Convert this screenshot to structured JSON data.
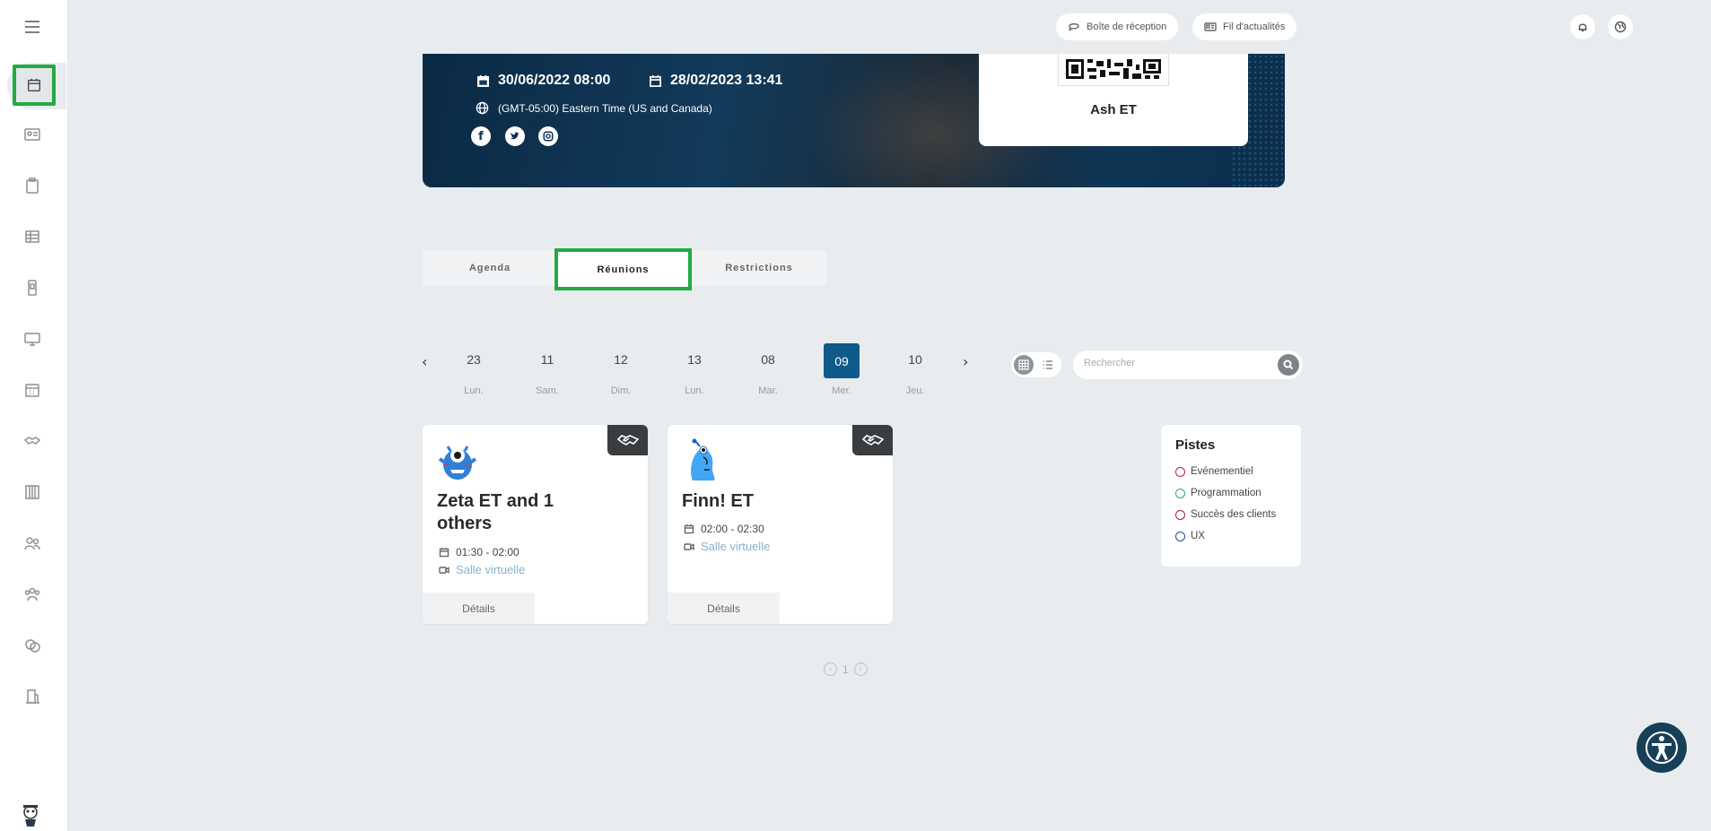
{
  "header": {
    "inbox_label": "Boîte de réception",
    "news_label": "Fil d'actualités"
  },
  "banner": {
    "start_date": "30/06/2022 08:00",
    "end_date": "28/02/2023 13:41",
    "timezone": "(GMT-05:00) Eastern Time (US and Canada)",
    "owner_name": "Ash ET",
    "social": [
      "facebook-icon",
      "twitter-icon",
      "instagram-icon"
    ]
  },
  "tabs": {
    "items": [
      "Agenda",
      "Réunions",
      "Restrictions"
    ],
    "active": "Réunions"
  },
  "dates": {
    "items": [
      {
        "num": "23",
        "day": "Lun."
      },
      {
        "num": "11",
        "day": "Sam."
      },
      {
        "num": "12",
        "day": "Dim."
      },
      {
        "num": "13",
        "day": "Lun."
      },
      {
        "num": "08",
        "day": "Mar."
      },
      {
        "num": "09",
        "day": "Mer."
      },
      {
        "num": "10",
        "day": "Jeu."
      }
    ],
    "selected": "09"
  },
  "search": {
    "placeholder": "Rechercher"
  },
  "meetings": [
    {
      "title": "Zeta ET and 1 others",
      "time": "01:30 - 02:00",
      "room": "Salle virtuelle",
      "details": "Détails"
    },
    {
      "title": "Finn! ET",
      "time": "02:00 - 02:30",
      "room": "Salle virtuelle",
      "details": "Détails"
    }
  ],
  "tracks": {
    "title": "Pistes",
    "items": [
      {
        "label": "Evénementiel",
        "color": "#c2185b"
      },
      {
        "label": "Programmation",
        "color": "#26a69a"
      },
      {
        "label": "Succès des clients",
        "color": "#ad1457"
      },
      {
        "label": "UX",
        "color": "#1e4e8c"
      }
    ]
  },
  "pagination": {
    "page": "1"
  },
  "colors": {
    "accent": "#0f5a8a",
    "highlight": "#22aa44",
    "accessibility": "#163f58"
  }
}
